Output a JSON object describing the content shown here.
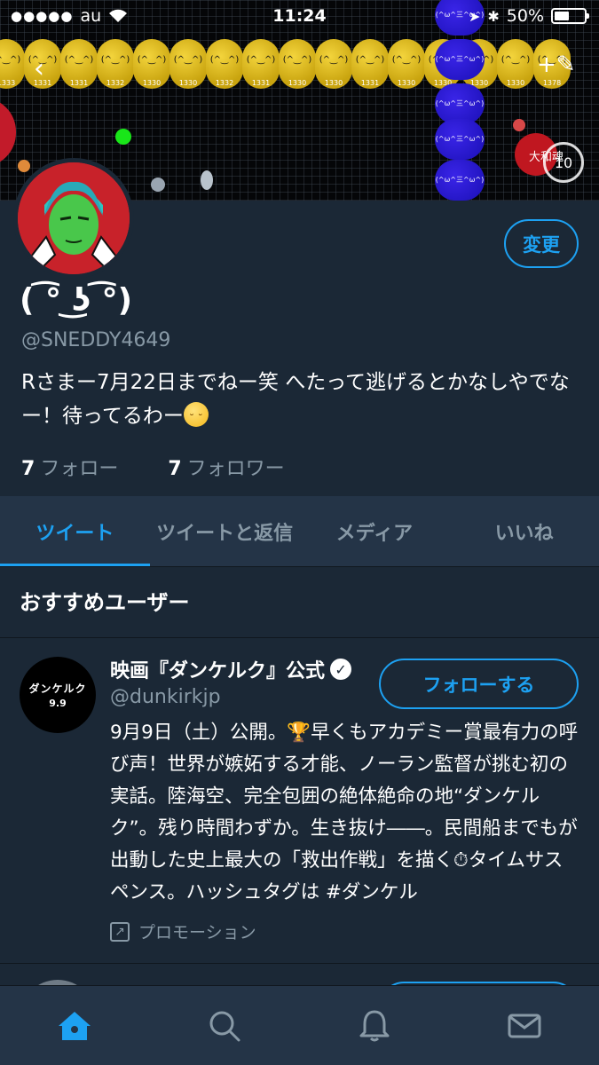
{
  "status_bar": {
    "signal": "●●●●●",
    "carrier": "au",
    "time": "11:24",
    "battery_text": "50%",
    "battery_level": 0.5
  },
  "header": {
    "back_icon": "back-chevron-icon",
    "compose_icon": "compose-feather-icon",
    "banner_label": "大和魂",
    "banner_counter": "10",
    "coin_scores": [
      "1333",
      "1331",
      "1331",
      "1332",
      "1330",
      "1330",
      "1332",
      "1331",
      "1330",
      "1330",
      "1331",
      "1330",
      "1330",
      "1330",
      "1330",
      "1378"
    ],
    "snake_label": "(^ω^三^ω^)"
  },
  "profile": {
    "display_name": "( ͡° ͜ʖ ͡°)",
    "handle": "@SNEDDY4649",
    "bio": "Rさまー7月22日までねー笑 へたって逃げるとかなしやでなー！待ってるわー",
    "follow_button": "変更",
    "following_count": "7",
    "following_label": "フォロー",
    "followers_count": "7",
    "followers_label": "フォロワー"
  },
  "tabs": [
    {
      "label": "ツイート",
      "active": true
    },
    {
      "label": "ツイートと返信",
      "active": false
    },
    {
      "label": "メディア",
      "active": false
    },
    {
      "label": "いいね",
      "active": false
    }
  ],
  "recommended": {
    "section_title": "おすすめユーザー",
    "user": {
      "name": "映画『ダンケルク』公式",
      "handle": "@dunkirkjp",
      "avatar_line1": "ダンケルク",
      "avatar_line2": "9.9",
      "follow_button": "フォローする",
      "description_1": "9月9日（土）公開。",
      "description_2": "早くもアカデミー賞最有力の呼び声！世界が嫉妬する才能、ノーラン監督が挑む初の実話。陸海空、完全包囲の絶体絶命の地“ダンケルク”。残り時間わずか。生き抜け――。民間船までもが出動した史上最大の「救出作戦」を描く",
      "description_3": "タイムサスペンス。ハッシュタグは #ダンケル",
      "promo_label": "プロモーション"
    }
  },
  "bottom_nav": [
    {
      "icon": "home-icon",
      "active": true
    },
    {
      "icon": "search-icon",
      "active": false
    },
    {
      "icon": "bell-icon",
      "active": false
    },
    {
      "icon": "mail-icon",
      "active": false
    }
  ],
  "colors": {
    "background": "#1b2836",
    "panel": "#243447",
    "accent": "#1da1f2",
    "muted": "#8899a6"
  }
}
